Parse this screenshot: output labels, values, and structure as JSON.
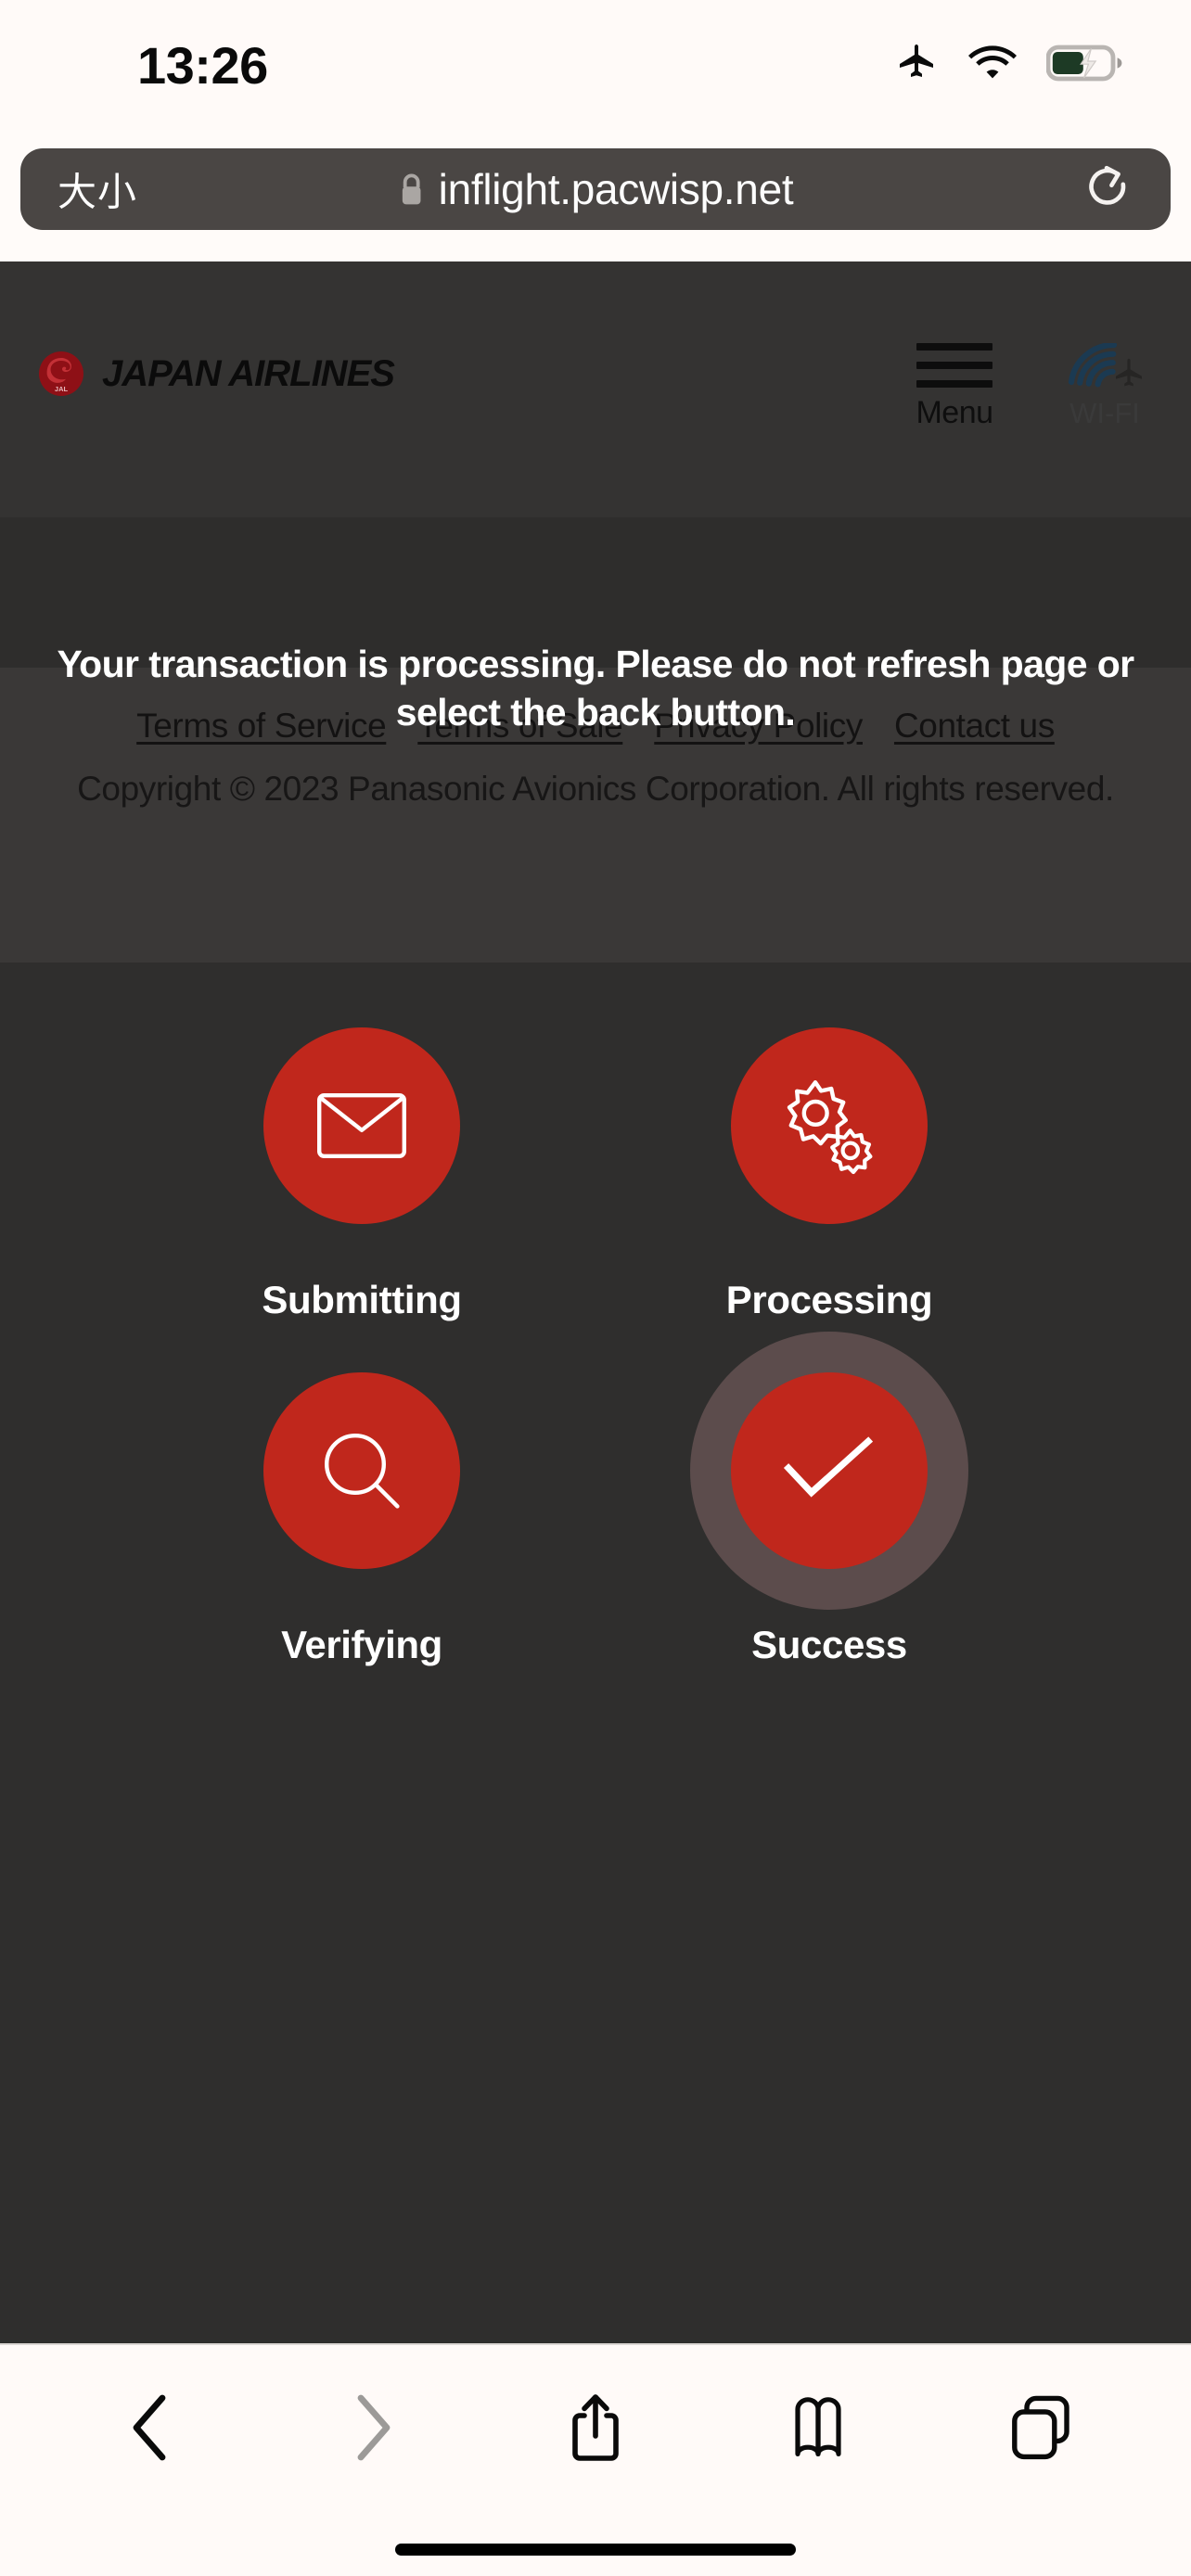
{
  "status_bar": {
    "time": "13:26",
    "icons": [
      "airplane-mode-icon",
      "wifi-icon",
      "battery-charging-icon"
    ],
    "battery_level_percent": 50
  },
  "browser": {
    "text_size_button": "大小",
    "url": "inflight.pacwisp.net",
    "secure": true,
    "reload_label": "reload-icon",
    "toolbar": {
      "back": "back-icon",
      "forward": "forward-icon",
      "share": "share-icon",
      "bookmarks": "bookmarks-icon",
      "tabs": "tabs-icon",
      "back_enabled": true,
      "forward_enabled": false
    }
  },
  "page": {
    "brand": {
      "name": "JAPAN AIRLINES",
      "mark": "jal-tsurumaru-icon",
      "mark_color": "#8e1016"
    },
    "header_actions": {
      "menu_label": "Menu",
      "wifi_label": "WI-FI"
    },
    "notice": "Your transaction is processing. Please do not refresh page or select the back button.",
    "footer": {
      "links": [
        "Terms of Service",
        "Terms of Sale",
        "Privacy Policy",
        "Contact us"
      ],
      "copyright": "Copyright © 2023 Panasonic Avionics Corporation. All rights reserved."
    },
    "progress_steps": [
      {
        "label": "Submitting",
        "icon": "envelope-icon",
        "active": false
      },
      {
        "label": "Processing",
        "icon": "gears-icon",
        "active": false
      },
      {
        "label": "Verifying",
        "icon": "magnifier-icon",
        "active": false
      },
      {
        "label": "Success",
        "icon": "checkmark-icon",
        "active": true
      }
    ],
    "colors": {
      "accent_red": "#c0271c",
      "halo": "#5c4c4c",
      "page_bg": "#2f2e2d",
      "header_bg": "#343332",
      "footer_bg": "#3a3837"
    }
  }
}
